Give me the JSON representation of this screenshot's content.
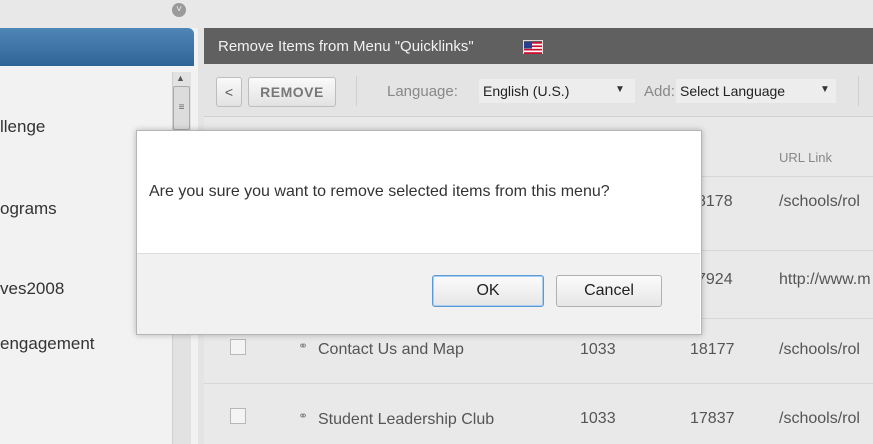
{
  "sidebar": {
    "items": [
      {
        "label": "llenge"
      },
      {
        "label": "ograms"
      },
      {
        "label": "ves2008"
      },
      {
        "label": "engagement"
      }
    ]
  },
  "panel": {
    "title": "Remove Items from Menu \"Quicklinks\""
  },
  "toolbar": {
    "back_glyph": "<",
    "remove_label": "REMOVE",
    "language_label": "Language:",
    "language_value": "English (U.S.)",
    "add_label": "Add:",
    "add_value": "Select Language"
  },
  "table": {
    "header_partial": ")",
    "url_header": "URL Link",
    "rows": [
      {
        "title": "",
        "num1": "",
        "num2": "8178",
        "url": "/schools/rol"
      },
      {
        "title": "",
        "num1": "",
        "num2": "7924",
        "url": "http://www.m"
      },
      {
        "title": "Contact Us and Map",
        "num1": "1033",
        "num2": "18177",
        "url": "/schools/rol"
      },
      {
        "title": "Student Leadership Club",
        "num1": "1033",
        "num2": "17837",
        "url": "/schools/rol"
      }
    ]
  },
  "dialog": {
    "message": "Are you sure you want to remove selected items from this menu?",
    "ok_label": "OK",
    "cancel_label": "Cancel"
  },
  "icons": {
    "collapse": "collapse-circle-icon",
    "flag": "us-flag-icon",
    "link": "link-chain-icon",
    "chevron": "chevron-down-icon"
  },
  "colors": {
    "title_bar": "#606060",
    "sidebar_header": "#3a70a5",
    "ok_focus": "#5a9ad6"
  }
}
